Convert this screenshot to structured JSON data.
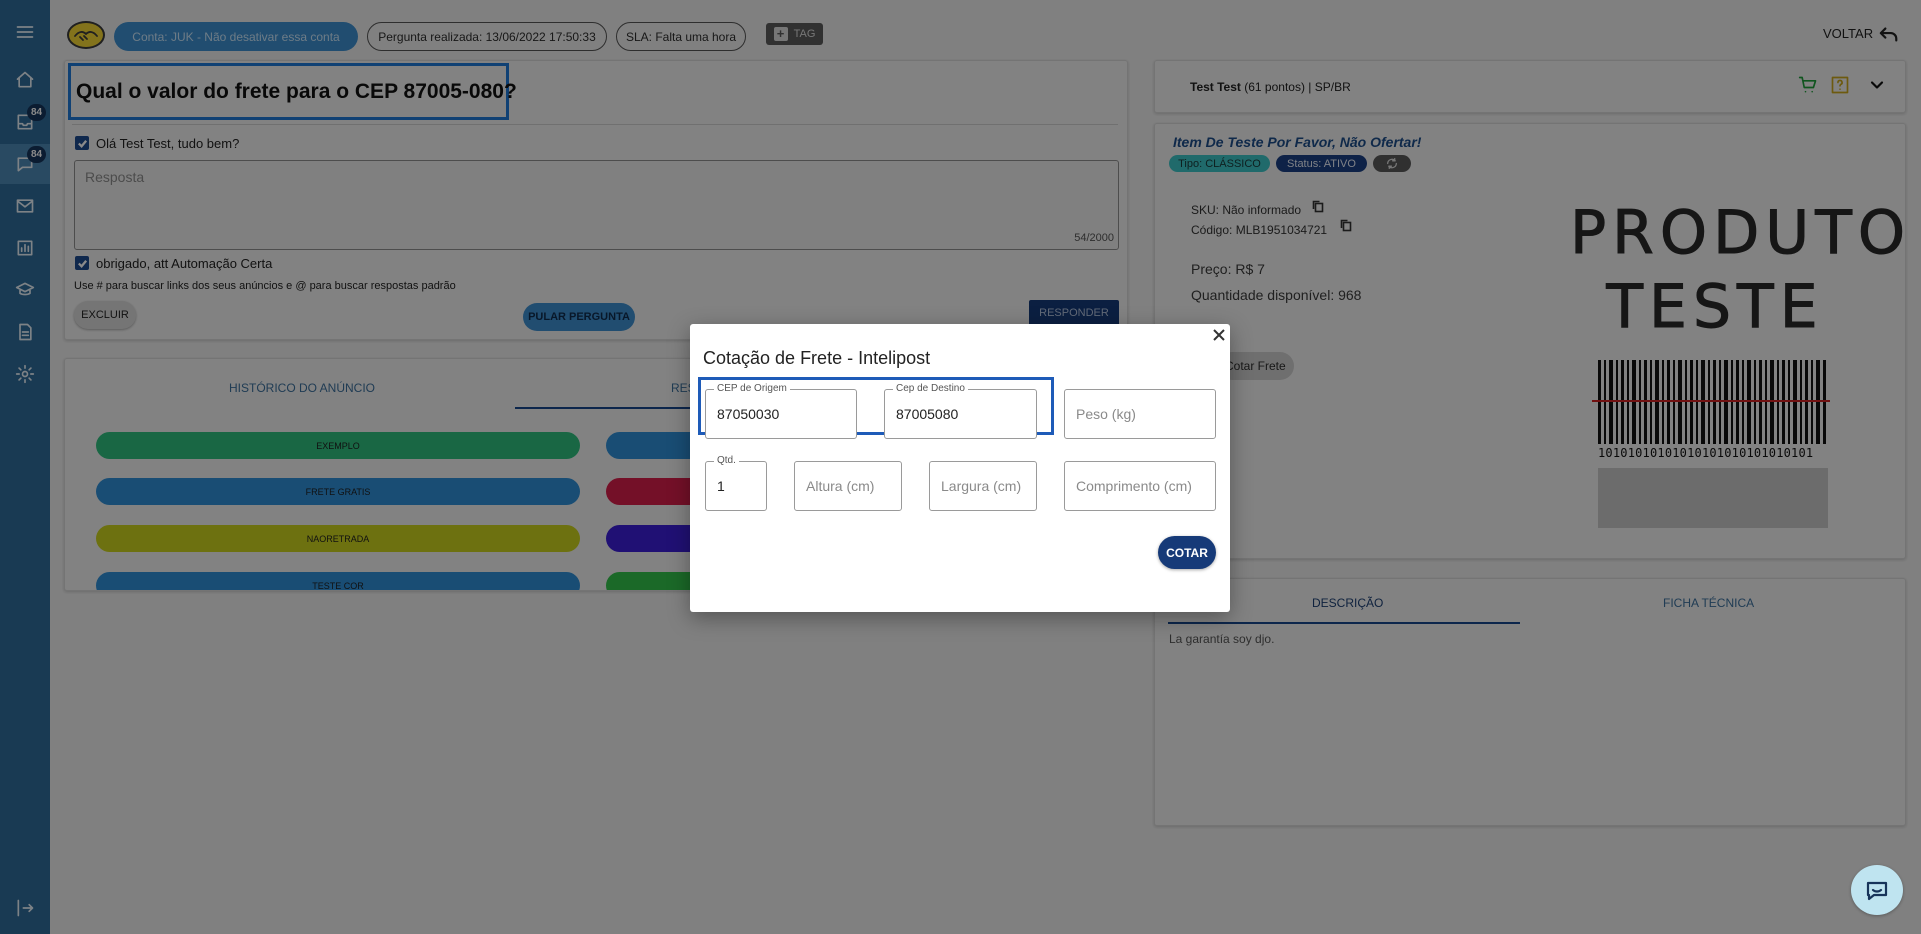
{
  "header": {
    "account_pill": "Conta: JUK - Não desativar essa conta",
    "question_date_pill": "Pergunta realizada: 13/06/2022 17:50:33",
    "sla_pill": "SLA: Falta uma hora",
    "tag_button": "TAG",
    "back_label": "VOLTAR"
  },
  "sidebar": {
    "badges": [
      "84",
      "84"
    ]
  },
  "question": {
    "title": "Qual o valor do frete para o CEP 87005-080?",
    "greeting_label": "Olá Test Test, tudo bem?",
    "answer_placeholder": "Resposta",
    "char_count": "54/2000",
    "signature_label": "obrigado, att Automação Certa",
    "hint": "Use # para buscar links dos seus anúncios e @ para buscar respostas padrão",
    "delete_button": "EXCLUIR",
    "skip_button": "PULAR PERGUNTA",
    "reply_button": "RESPONDER"
  },
  "history": {
    "tab_history": "HISTÓRICO DO ANÚNCIO",
    "tab_answers_partial": "RES",
    "tags": [
      {
        "label": "EXEMPLO",
        "color": "#2fbf7f"
      },
      {
        "label": "FRETE GRATIS",
        "color": "#2f8fd6"
      },
      {
        "label": "NAORETRADA",
        "color": "#c9d11e"
      },
      {
        "label": "TESTE COR",
        "color": "#2f8fd6"
      }
    ],
    "tags_right_colors": [
      "#2f8fd6",
      "#d61f4a",
      "#3c1fd6",
      "#32c24a"
    ]
  },
  "buyer": {
    "name": "Test Test",
    "detail": " (61 pontos) | SP/BR"
  },
  "item": {
    "title": "Item De Teste Por Favor, Não Ofertar!",
    "type_chip": "Tipo: CLÁSSICO",
    "status_chip": "Status: ATIVO",
    "sku": "SKU: Não informado",
    "code": "Código: MLB1951034721",
    "price": "Preço: R$ 7",
    "quantity": "Quantidade disponível: 968",
    "quote_button": "Cotar Frete",
    "image_line1": "PRODUTO",
    "image_line2": "TESTE",
    "barcode_digits": "10101010101010101010101010101"
  },
  "description": {
    "tab_description": "DESCRIÇÃO",
    "tab_specs": "FICHA TÉCNICA",
    "text": "La garantía soy djo."
  },
  "modal": {
    "title": "Cotação de Frete - Intelipost",
    "origin_label": "CEP de Origem",
    "origin_value": "87050030",
    "dest_label": "Cep de Destino",
    "dest_value": "87005080",
    "weight_placeholder": "Peso (kg)",
    "qty_label": "Qtd.",
    "qty_value": "1",
    "height_placeholder": "Altura (cm)",
    "width_placeholder": "Largura (cm)",
    "length_placeholder": "Comprimento (cm)",
    "quote_button": "COTAR"
  }
}
